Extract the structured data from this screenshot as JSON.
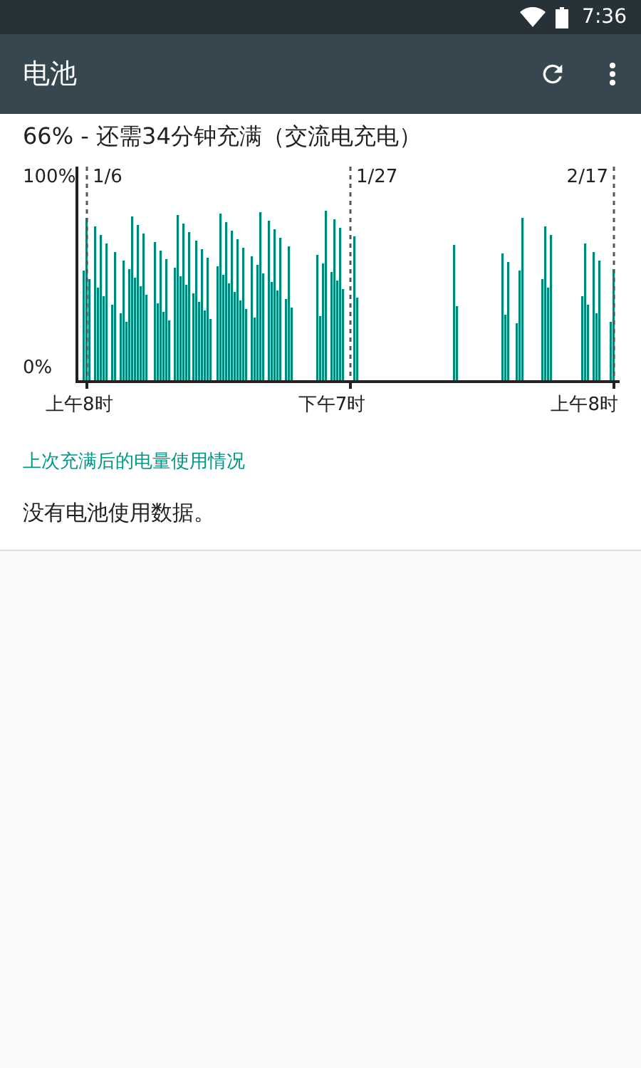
{
  "status_bar": {
    "time": "7:36"
  },
  "app_bar": {
    "title": "电池"
  },
  "summary": "66% - 还需34分钟充满（交流电充电）",
  "graph": {
    "y_labels": [
      "100%",
      "0%"
    ],
    "date_markers": [
      "1/6",
      "1/27",
      "2/17"
    ],
    "x_labels": [
      "上午8时",
      "下午7时",
      "上午8时"
    ]
  },
  "link": "上次充满后的电量使用情况",
  "message": "没有电池使用数据。"
}
